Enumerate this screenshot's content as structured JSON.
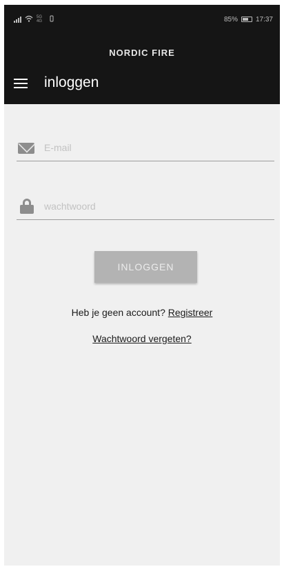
{
  "statusbar": {
    "network_small": "5G 4G",
    "battery_percent": "85%",
    "time": "17:37"
  },
  "appbar": {
    "brand": "NORDIC FIRE",
    "title": "inloggen",
    "menu_icon": "hamburger-menu-icon"
  },
  "form": {
    "email": {
      "placeholder": "E-mail",
      "value": "",
      "icon": "envelope-icon"
    },
    "password": {
      "placeholder": "wachtwoord",
      "value": "",
      "icon": "lock-icon"
    },
    "login_label": "INLOGGEN"
  },
  "register": {
    "prompt": "Heb je geen account? ",
    "link_label": "Registreer"
  },
  "forgot_label": "Wachtwoord vergeten?",
  "colors": {
    "appbar_bg": "#151515",
    "page_bg": "#f0f0f0",
    "button_bg": "#b3b3b3"
  }
}
